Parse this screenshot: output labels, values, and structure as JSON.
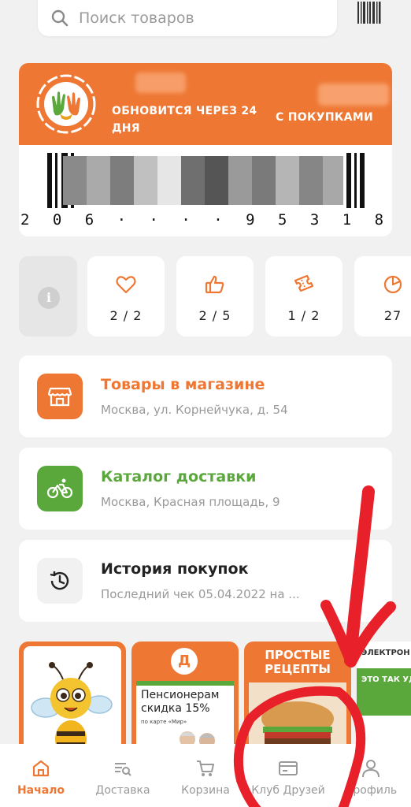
{
  "search": {
    "placeholder": "Поиск товаров"
  },
  "card": {
    "update_text": "ОБНОВИТСЯ ЧЕРЕЗ 24 ДНЯ",
    "purchases_text": "С ПОКУПКАМИ",
    "number": "2 0 6 · · · · 9 5 3 1 8"
  },
  "stats": [
    {
      "icon": "heart-icon",
      "value": "2 / 2"
    },
    {
      "icon": "thumbs-up-icon",
      "value": "2 / 5"
    },
    {
      "icon": "ticket-icon",
      "value": "1 / 2"
    },
    {
      "icon": "pie-chart-icon",
      "value": "27"
    }
  ],
  "stores": [
    {
      "title": "Товары в магазине",
      "address": "Москва, ул. Корнейчука, д. 54",
      "color": "#ee7733",
      "icon": "store-icon"
    },
    {
      "title": "Каталог доставки",
      "address": "Москва, Красная площадь, 9",
      "color": "#5aa83c",
      "icon": "bicycle-icon"
    },
    {
      "title": "История покупок",
      "address": "Последний чек 05.04.2022 на ...",
      "color": "#222222",
      "icon": "history-icon"
    }
  ],
  "promos": [
    {
      "label": ""
    },
    {
      "logo": "Д",
      "title": "Пенсионерам скидка 15%",
      "subtitle": "по карте «Мир»"
    },
    {
      "title": "ПРОСТЫЕ РЕЦЕПТЫ"
    },
    {
      "title": "ЭЛЕКТРОН ВМЕСТО Б",
      "subtitle": "ЭТО ТАК УДОБНО!"
    }
  ],
  "nav": [
    {
      "label": "Начало",
      "icon": "home-icon",
      "active": true
    },
    {
      "label": "Доставка",
      "icon": "catalog-icon"
    },
    {
      "label": "Корзина",
      "icon": "cart-icon"
    },
    {
      "label": "Клуб Друзей",
      "icon": "card-icon"
    },
    {
      "label": "Профиль",
      "icon": "profile-icon"
    }
  ],
  "colors": {
    "accent": "#ee7733",
    "green": "#5aa83c",
    "annotation": "#e8202a"
  }
}
